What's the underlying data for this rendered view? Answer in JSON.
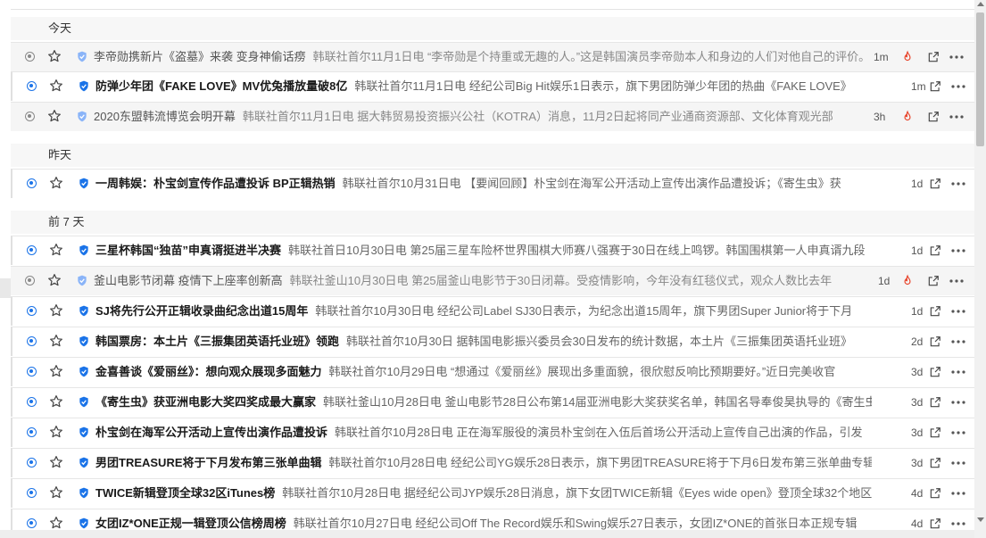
{
  "sections": [
    {
      "label": "今天",
      "items": [
        {
          "read": true,
          "title": "李帝勋携新片《盗墓》来袭 变身神偷话痨",
          "summary": "韩联社首尔11月1日电 “李帝勋是个持重或无趣的人。”这是韩国演员李帝勋本人和身边的人们对他自己的评价。",
          "time": "1m",
          "hot": true
        },
        {
          "read": false,
          "title": "防弹少年团《FAKE LOVE》MV优兔播放量破8亿",
          "summary": "韩联社首尔11月1日电 经纪公司Big Hit娱乐1日表示，旗下男团防弹少年团的热曲《FAKE LOVE》",
          "time": "1m",
          "hot": false
        },
        {
          "read": true,
          "title": "2020东盟韩流博览会明开幕",
          "summary": "韩联社首尔11月1日电 据大韩贸易投资振兴公社（KOTRA）消息，11月2日起将同产业通商资源部、文化体育观光部",
          "time": "3h",
          "hot": true
        }
      ]
    },
    {
      "label": "昨天",
      "items": [
        {
          "read": false,
          "title": "一周韩娱：朴宝剑宣传作品遭投诉 BP正辑热销",
          "summary": "韩联社首尔10月31日电 【要闻回顾】朴宝剑在海军公开活动上宣传出演作品遭投诉；《寄生虫》获",
          "time": "1d",
          "hot": false
        }
      ]
    },
    {
      "label": "前 7 天",
      "items": [
        {
          "read": false,
          "title": "三星杯韩国“独苗”申真谞挺进半决赛",
          "summary": "韩联社首日10月30日电 第25届三星车险杯世界围棋大师赛八强赛于30日在线上鸣锣。韩国围棋第一人申真谞九段",
          "time": "1d",
          "hot": false
        },
        {
          "read": true,
          "title": "釜山电影节闭幕 疫情下上座率创新高",
          "summary": "韩联社釜山10月30日电 第25届釜山电影节于30日闭幕。受疫情影响，今年没有红毯仪式，观众人数比去年",
          "time": "1d",
          "hot": true
        },
        {
          "read": false,
          "title": "SJ将先行公开正辑收录曲纪念出道15周年",
          "summary": "韩联社首尔10月30日电 经纪公司Label SJ30日表示，为纪念出道15周年，旗下男团Super Junior将于下月",
          "time": "1d",
          "hot": false
        },
        {
          "read": false,
          "title": "韩国票房：本土片《三振集团英语托业班》领跑",
          "summary": "韩联社首尔10月30日 据韩国电影振兴委员会30日发布的统计数据，本土片《三振集团英语托业班》",
          "time": "2d",
          "hot": false
        },
        {
          "read": false,
          "title": "金喜善谈《爱丽丝》：想向观众展现多面魅力",
          "summary": "韩联社首尔10月29日电 “想通过《爱丽丝》展现出多重面貌，很欣慰反响比预期要好。”近日完美收官",
          "time": "3d",
          "hot": false
        },
        {
          "read": false,
          "title": "《寄生虫》获亚洲电影大奖四奖成最大赢家",
          "summary": "韩联社釜山10月28日电 釜山电影节28日公布第14届亚洲电影大奖获奖名单，韩国名导奉俊昊执导的《寄生虫》",
          "time": "3d",
          "hot": false
        },
        {
          "read": false,
          "title": "朴宝剑在海军公开活动上宣传出演作品遭投诉",
          "summary": "韩联社首尔10月28日电 正在海军服役的演员朴宝剑在入伍后首场公开活动上宣传自己出演的作品，引发",
          "time": "3d",
          "hot": false
        },
        {
          "read": false,
          "title": "男团TREASURE将于下月发布第三张单曲辑",
          "summary": "韩联社首尔10月28日电 经纪公司YG娱乐28日表示，旗下男团TREASURE将于下月6日发布第三张单曲专辑",
          "time": "3d",
          "hot": false
        },
        {
          "read": false,
          "title": "TWICE新辑登顶全球32区iTunes榜",
          "summary": "韩联社首尔10月28日电 据经纪公司JYP娱乐28日消息，旗下女团TWICE新辑《Eyes wide open》登顶全球32个地区",
          "time": "4d",
          "hot": false
        },
        {
          "read": false,
          "title": "女团IZ*ONE正规一辑登顶公信榜周榜",
          "summary": "韩联社首尔10月27日电 经纪公司Off The Record娱乐和Swing娱乐27日表示，女团IZ*ONE的首张日本正规专辑",
          "time": "4d",
          "hot": false
        }
      ]
    }
  ],
  "icons": {
    "unread_dot": "radio-dot-icon",
    "star": "star-outline-icon",
    "source": "shield-check-icon",
    "hot": "fire-icon",
    "open": "external-link-icon",
    "more": "more-horizontal-icon"
  },
  "colors": {
    "accent": "#1a73e8",
    "hot": "#e8452c",
    "read_bg": "#f5f5f5"
  }
}
